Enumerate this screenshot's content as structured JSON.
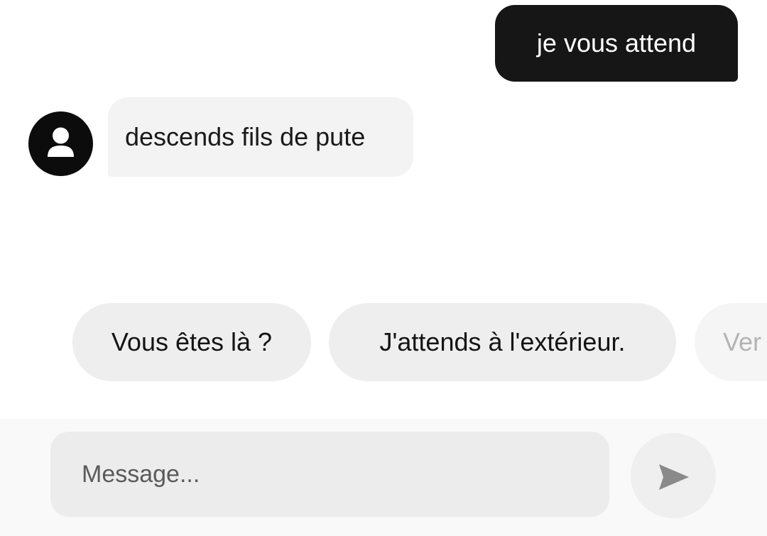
{
  "chat": {
    "messages": [
      {
        "direction": "outgoing",
        "text": "je vous attend"
      },
      {
        "direction": "incoming",
        "text": "descends fils de pute"
      }
    ]
  },
  "quick_replies": [
    {
      "label": "Vous êtes là ?"
    },
    {
      "label": "J'attends à l'extérieur."
    },
    {
      "label": "Ver"
    }
  ],
  "composer": {
    "placeholder": "Message...",
    "value": ""
  },
  "icons": {
    "avatar": "user-icon",
    "send": "send-icon"
  },
  "colors": {
    "outgoing_bubble": "#161616",
    "incoming_bubble": "#f3f3f3",
    "chip": "#eeeeee",
    "send_icon": "#8a8a8a"
  }
}
